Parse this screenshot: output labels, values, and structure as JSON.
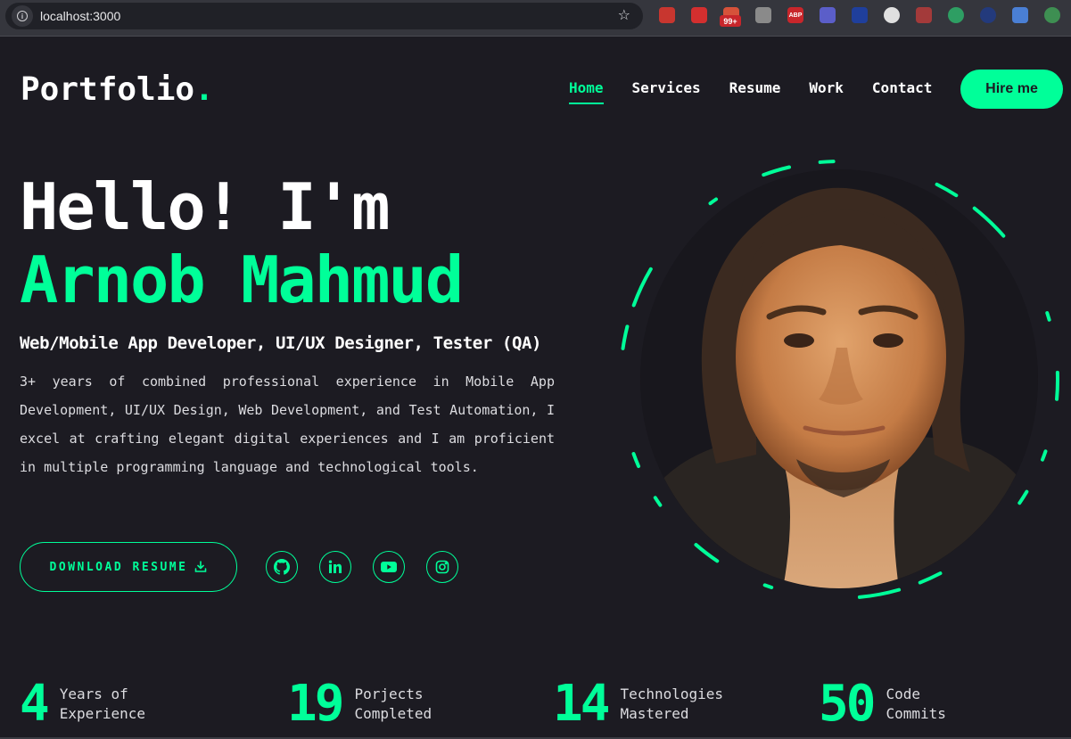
{
  "browser": {
    "url": "localhost:3000",
    "extensions": [
      {
        "name": "shield-extension",
        "color": "#c8362f"
      },
      {
        "name": "hand-stop-extension",
        "color": "#d32f2f"
      },
      {
        "name": "rss-extension",
        "color": "#d6523a",
        "badge": "99+"
      },
      {
        "name": "shoe-extension",
        "color": "#8a8a8a"
      },
      {
        "name": "adblock-plus-extension",
        "color": "#c8262b",
        "text": "ABP"
      },
      {
        "name": "blocked-compass-extension",
        "color": "#5b5ec9"
      },
      {
        "name": "mail-extension",
        "color": "#1f3f9c"
      },
      {
        "name": "circle-extension",
        "color": "#e0e0e0"
      },
      {
        "name": "bug-extension",
        "color": "#a33a3a"
      },
      {
        "name": "target-extension",
        "color": "#2e9e63"
      },
      {
        "name": "checkmark-extension",
        "color": "#233a7c"
      },
      {
        "name": "translate-extension",
        "color": "#4a7fd4"
      },
      {
        "name": "robot-extension",
        "color": "#3e8f52"
      }
    ]
  },
  "header": {
    "logo_text": "Portfolio",
    "logo_dot": ".",
    "nav": [
      {
        "label": "Home",
        "active": true
      },
      {
        "label": "Services",
        "active": false
      },
      {
        "label": "Resume",
        "active": false
      },
      {
        "label": "Work",
        "active": false
      },
      {
        "label": "Contact",
        "active": false
      }
    ],
    "hire_label": "Hire me"
  },
  "hero": {
    "greeting": "Hello! I'm",
    "name": "Arnob Mahmud",
    "role": "Web/Mobile App Developer, UI/UX Designer, Tester (QA)",
    "bio": "3+ years of combined professional experience in Mobile App Development, UI/UX Design, Web Development, and Test Automation, I excel at crafting elegant digital experiences and I am proficient in multiple programming language and technological tools.",
    "download_label": "DOWNLOAD RESUME",
    "socials": [
      "github-icon",
      "linkedin-icon",
      "youtube-icon",
      "instagram-icon"
    ]
  },
  "stats": [
    {
      "value": "4",
      "label_line1": "Years of",
      "label_line2": "Experience"
    },
    {
      "value": "19",
      "label_line1": "Porjects",
      "label_line2": "Completed"
    },
    {
      "value": "14",
      "label_line1": "Technologies",
      "label_line2": "Mastered"
    },
    {
      "value": "50",
      "label_line1": "Code",
      "label_line2": "Commits"
    }
  ],
  "colors": {
    "accent": "#00ff99",
    "background": "#1c1b22",
    "text": "#ffffff"
  }
}
